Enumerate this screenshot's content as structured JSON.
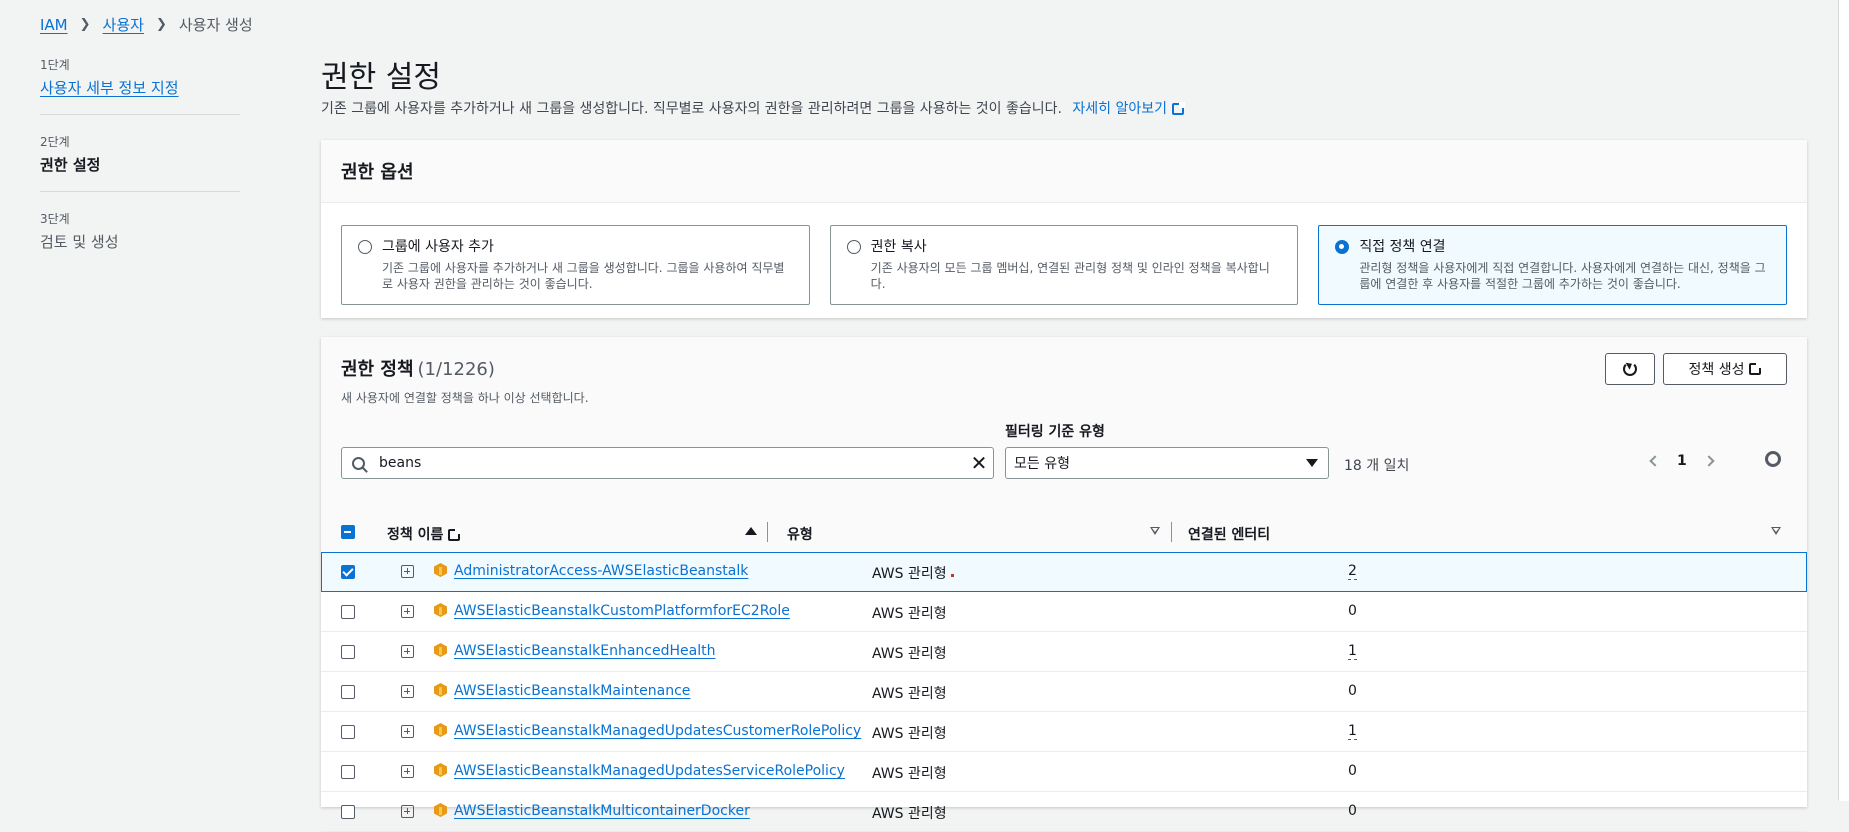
{
  "breadcrumb": {
    "items": [
      "IAM",
      "사용자"
    ],
    "current": "사용자 생성"
  },
  "steps": [
    {
      "num": "1단계",
      "label": "사용자 세부 정보 지정"
    },
    {
      "num": "2단계",
      "label": "권한 설정"
    },
    {
      "num": "3단계",
      "label": "검토 및 생성"
    }
  ],
  "page": {
    "title": "권한 설정",
    "description": "기존 그룹에 사용자를 추가하거나 새 그룹을 생성합니다. 직무별로 사용자의 권한을 관리하려면 그룹을 사용하는 것이 좋습니다.",
    "learn_more": "자세히 알아보기"
  },
  "options": {
    "header": "권한 옵션",
    "tiles": [
      {
        "title": "그룹에 사용자 추가",
        "desc": "기존 그룹에 사용자를 추가하거나 새 그룹을 생성합니다. 그룹을 사용하여 직무별로 사용자 권한을 관리하는 것이 좋습니다.",
        "selected": false
      },
      {
        "title": "권한 복사",
        "desc": "기존 사용자의 모든 그룹 멤버십, 연결된 관리형 정책 및 인라인 정책을 복사합니다.",
        "selected": false
      },
      {
        "title": "직접 정책 연결",
        "desc": "관리형 정책을 사용자에게 직접 연결합니다. 사용자에게 연결하는 대신, 정책을 그룹에 연결한 후 사용자를 적절한 그룹에 추가하는 것이 좋습니다.",
        "selected": true
      }
    ]
  },
  "policies": {
    "title": "권한 정책",
    "count": "(1/1226)",
    "description": "새 사용자에 연결할 정책을 하나 이상 선택합니다.",
    "create_label": "정책 생성",
    "filter_label": "필터링 기준 유형",
    "search_value": "beans",
    "filter_value": "모든 유형",
    "match_text": "18 개 일치",
    "page": "1",
    "columns": {
      "name": "정책 이름",
      "type": "유형",
      "entities": "연결된 엔터티"
    },
    "rows": [
      {
        "name": "AdministratorAccess-AWSElasticBeanstalk",
        "type": "AWS 관리형",
        "entities": "2",
        "checked": true,
        "dotted": true,
        "dot": true
      },
      {
        "name": "AWSElasticBeanstalkCustomPlatformforEC2Role",
        "type": "AWS 관리형",
        "entities": "0",
        "checked": false,
        "dotted": false
      },
      {
        "name": "AWSElasticBeanstalkEnhancedHealth",
        "type": "AWS 관리형",
        "entities": "1",
        "checked": false,
        "dotted": true
      },
      {
        "name": "AWSElasticBeanstalkMaintenance",
        "type": "AWS 관리형",
        "entities": "0",
        "checked": false,
        "dotted": false
      },
      {
        "name": "AWSElasticBeanstalkManagedUpdatesCustomerRolePolicy",
        "type": "AWS 관리형",
        "entities": "1",
        "checked": false,
        "dotted": true
      },
      {
        "name": "AWSElasticBeanstalkManagedUpdatesServiceRolePolicy",
        "type": "AWS 관리형",
        "entities": "0",
        "checked": false,
        "dotted": false
      },
      {
        "name": "AWSElasticBeanstalkMulticontainerDocker",
        "type": "AWS 관리형",
        "entities": "0",
        "checked": false,
        "dotted": false
      }
    ]
  },
  "colors": {
    "accent": "#0972d3",
    "background": "#f2f3f3",
    "selected_bg": "#f1faff"
  }
}
